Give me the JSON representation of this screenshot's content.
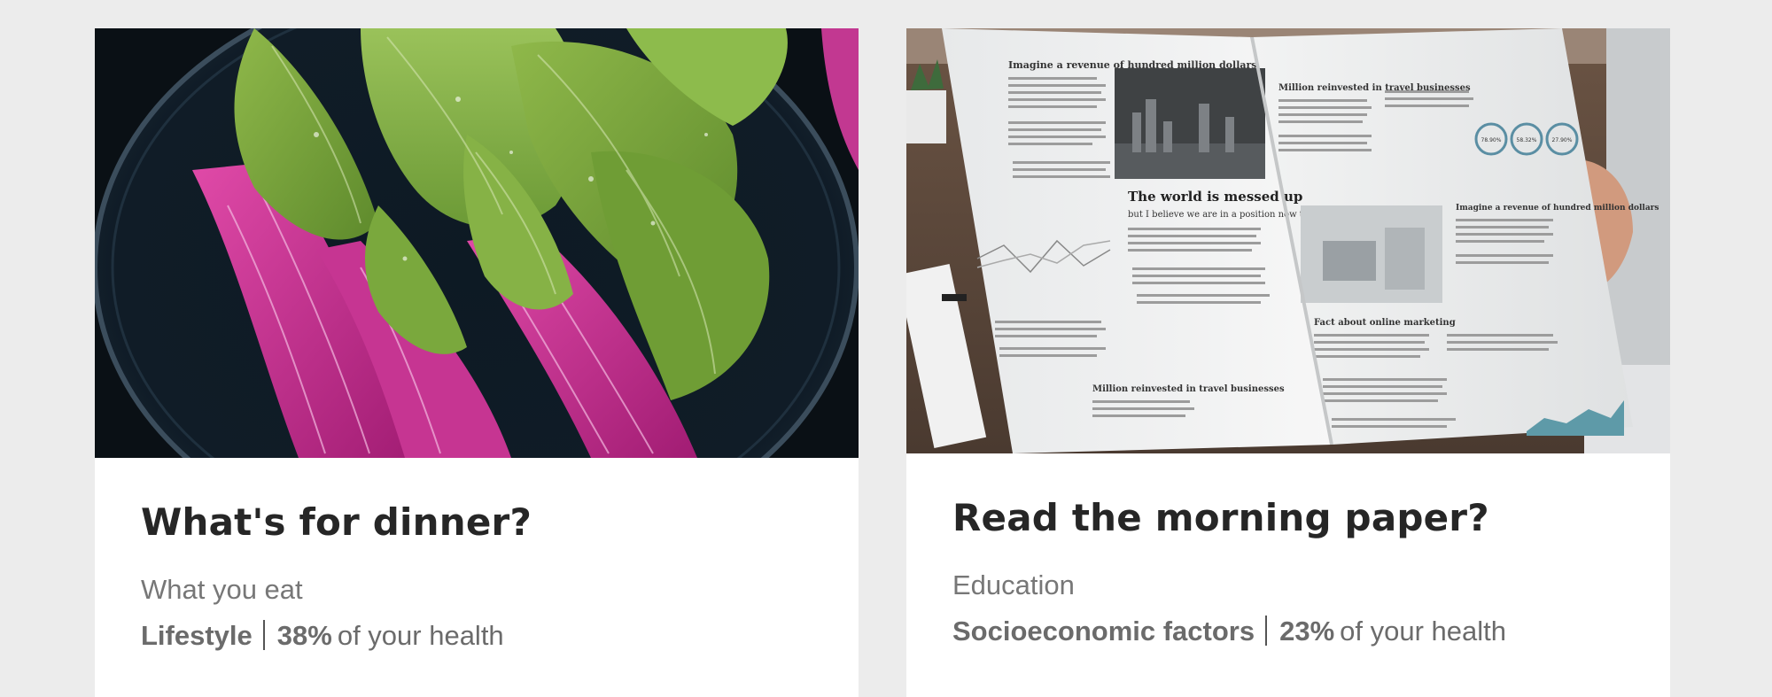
{
  "cards": [
    {
      "title": "What's for dinner?",
      "subtitle": "What you eat",
      "category": "Lifestyle",
      "percent": "38%",
      "suffix": "of your health",
      "image_icon": "cabbage-photo",
      "colors": {
        "accent": "#c02a8a",
        "leaf": "#7da83a"
      }
    },
    {
      "title": "Read the morning paper?",
      "subtitle": "Education",
      "category": "Socioeconomic factors",
      "percent": "23%",
      "suffix": "of your health",
      "image_icon": "newspaper-photo",
      "newspaper": {
        "headline_left": "Imagine a revenue of hundred million dollars",
        "headline_world": "The world is messed up",
        "subhead_world": "but I believe we are in a position now to help",
        "headline_right_top": "Million reinvested in travel businesses",
        "headline_right_mid": "Imagine a revenue of hundred million dollars",
        "headline_fact": "Fact about online marketing",
        "headline_bottom": "Million reinvested in travel businesses",
        "chart_stats": [
          "78.90%",
          "58.32%",
          "27.90%"
        ]
      }
    }
  ]
}
